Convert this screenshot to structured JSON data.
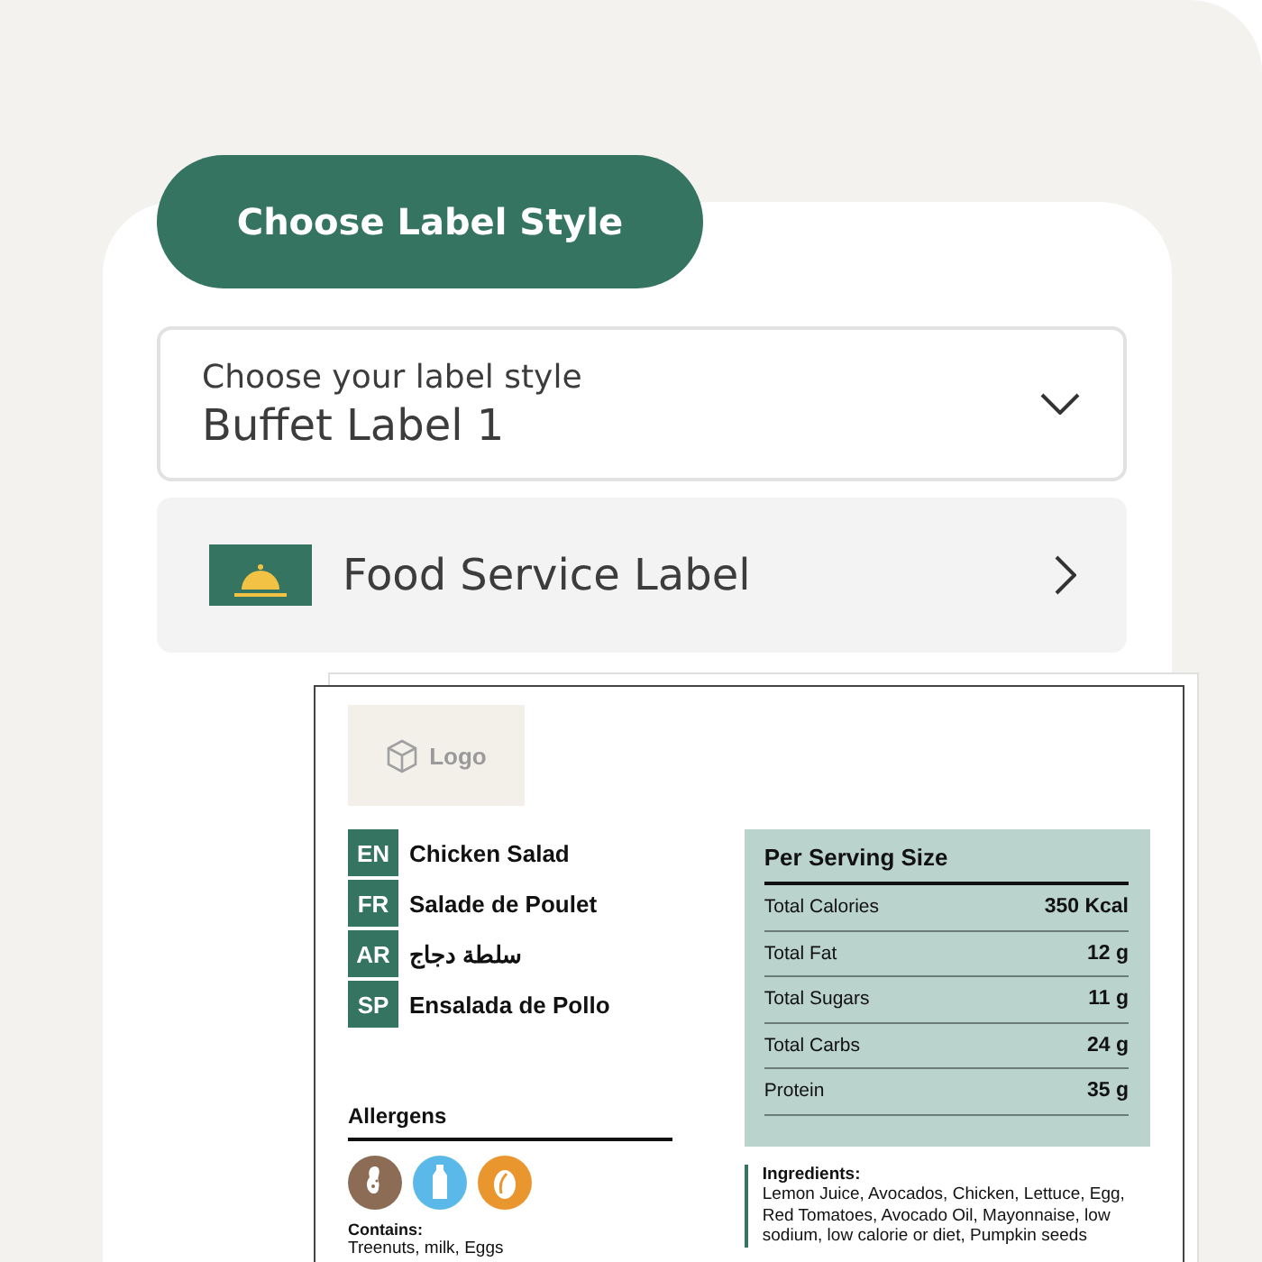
{
  "header_button": "Choose Label Style",
  "style_select": {
    "label": "Choose your label style",
    "value": "Buffet Label 1"
  },
  "label_type": {
    "label": "Food Service Label"
  },
  "label_preview": {
    "logo": "Logo",
    "names": [
      {
        "lang": "EN",
        "name": "Chicken Salad"
      },
      {
        "lang": "FR",
        "name": "Salade de Poulet"
      },
      {
        "lang": "AR",
        "name": "سلطة دجاج"
      },
      {
        "lang": "SP",
        "name": "Ensalada de Pollo"
      }
    ],
    "allergens": {
      "title": "Allergens",
      "items": [
        {
          "kind": "nut",
          "color": "#8c6c55"
        },
        {
          "kind": "milk",
          "color": "#5bb9e9"
        },
        {
          "kind": "egg",
          "color": "#e9962f"
        }
      ],
      "contains_label": "Contains:",
      "contains": "Treenuts, milk, Eggs"
    },
    "nutrition": {
      "title": "Per Serving Size",
      "rows": [
        {
          "name": "Total Calories",
          "value": "350 Kcal"
        },
        {
          "name": "Total Fat",
          "value": "12 g"
        },
        {
          "name": "Total Sugars",
          "value": "11 g"
        },
        {
          "name": "Total Carbs",
          "value": "24 g"
        },
        {
          "name": "Protein",
          "value": "35 g"
        }
      ]
    },
    "ingredients": {
      "title": "Ingredients:",
      "text": "Lemon Juice, Avocados, Chicken, Lettuce, Egg, Red Tomatoes, Avocado Oil, Mayonnaise, low sodium, low calorie or diet, Pumpkin seeds"
    }
  }
}
